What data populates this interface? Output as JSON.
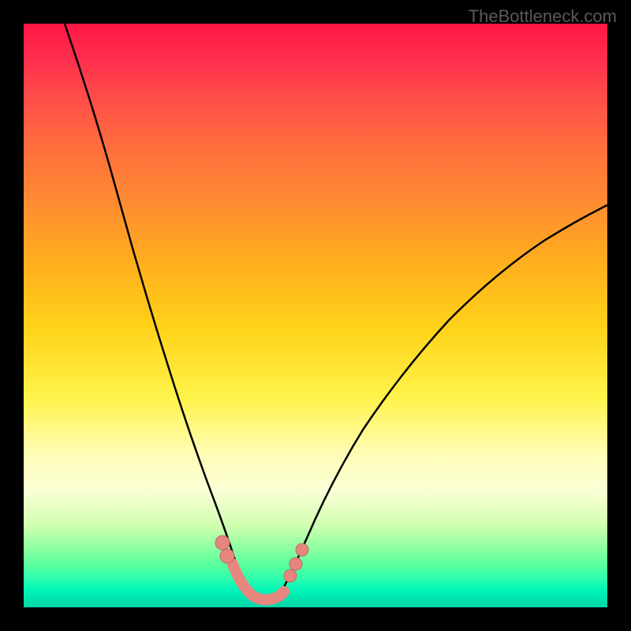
{
  "watermark": "TheBottleneck.com",
  "chart_data": {
    "type": "line",
    "title": "",
    "xlabel": "",
    "ylabel": "",
    "xlim": [
      0,
      100
    ],
    "ylim": [
      0,
      100
    ],
    "series": [
      {
        "name": "left-curve",
        "x": [
          7,
          10,
          13,
          16,
          19,
          22,
          25,
          28,
          30,
          32,
          34,
          35.5,
          37
        ],
        "values": [
          100,
          90,
          80,
          70,
          60,
          50,
          40,
          30,
          22,
          15,
          9,
          5,
          2
        ]
      },
      {
        "name": "right-curve",
        "x": [
          44,
          46,
          49,
          53,
          58,
          64,
          71,
          79,
          88,
          98,
          100
        ],
        "values": [
          2,
          5,
          10,
          17,
          25,
          33,
          41,
          49,
          56,
          63,
          65
        ]
      },
      {
        "name": "valley-flat",
        "x": [
          37,
          38.5,
          40,
          42,
          43,
          44
        ],
        "values": [
          2,
          1,
          1,
          1,
          1.5,
          2
        ]
      }
    ],
    "markers": [
      {
        "x": 33.5,
        "y": 11
      },
      {
        "x": 34.5,
        "y": 8
      },
      {
        "x": 36,
        "y": 4
      },
      {
        "x": 37.5,
        "y": 2
      },
      {
        "x": 39,
        "y": 1
      },
      {
        "x": 40.5,
        "y": 1
      },
      {
        "x": 42,
        "y": 1.5
      },
      {
        "x": 43.5,
        "y": 2
      },
      {
        "x": 45,
        "y": 4
      },
      {
        "x": 46,
        "y": 6
      },
      {
        "x": 47,
        "y": 8.5
      },
      {
        "x": 48,
        "y": 11
      }
    ],
    "colors": {
      "curve": "#000000",
      "markers": "#e6867e",
      "gradient_top": "#ff1744",
      "gradient_mid": "#ffd219",
      "gradient_bottom": "#00d6a8"
    }
  }
}
